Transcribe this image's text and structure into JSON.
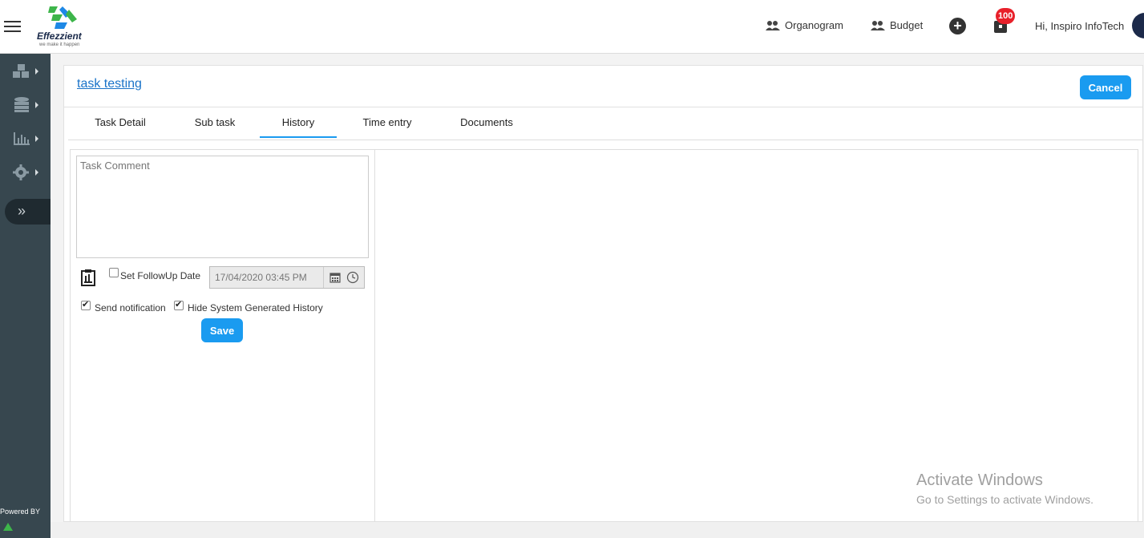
{
  "header": {
    "brand_name": "Effezzient",
    "brand_tagline": "we make it happen",
    "organogram_label": "Organogram",
    "budget_label": "Budget",
    "notification_count": "100",
    "greeting": "Hi, Inspiro InfoTech",
    "brand_colors": {
      "logo_green": "#3db54a",
      "logo_blue": "#1e88e5"
    }
  },
  "sidebar": {
    "items": [
      {
        "icon": "cubes-icon"
      },
      {
        "icon": "database-icon"
      },
      {
        "icon": "bar-chart-icon"
      },
      {
        "icon": "gear-icon"
      }
    ],
    "toggle_glyph": "»",
    "powered_by": "Powered BY"
  },
  "page": {
    "task_title": "task testing",
    "cancel_label": "Cancel",
    "tabs": [
      {
        "label": "Task Detail",
        "active": false
      },
      {
        "label": "Sub task",
        "active": false
      },
      {
        "label": "History",
        "active": true
      },
      {
        "label": "Time entry",
        "active": false
      },
      {
        "label": "Documents",
        "active": false
      }
    ]
  },
  "history_form": {
    "comment_placeholder": "Task Comment",
    "followup_label": "Set FollowUp Date",
    "followup_checked": false,
    "followup_date": "17/04/2020 03:45 PM",
    "send_notification_label": "Send notification",
    "send_notification_checked": true,
    "hide_system_label": "Hide System Generated History",
    "hide_system_checked": true,
    "save_label": "Save"
  },
  "watermark": {
    "line1": "Activate Windows",
    "line2": "Go to Settings to activate Windows."
  },
  "colors": {
    "accent": "#1a9bf0",
    "sidebar_bg": "#37474f",
    "badge": "#e8202a",
    "link": "#1a73c8"
  }
}
